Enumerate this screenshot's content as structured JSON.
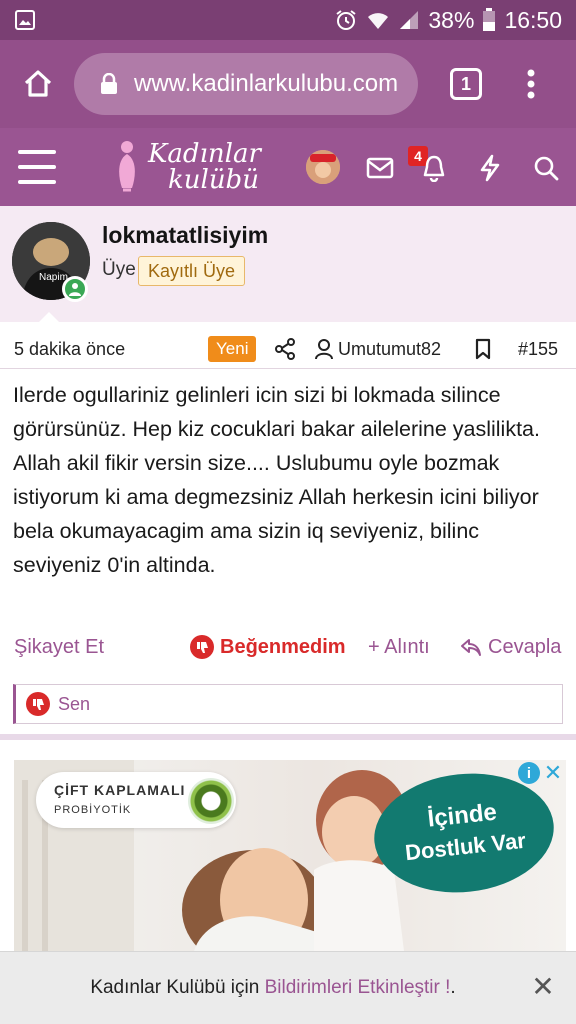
{
  "status_bar": {
    "battery": "38%",
    "time": "16:50"
  },
  "browser": {
    "url": "www.kadinlarkulubu.com",
    "tab_count": "1"
  },
  "site_header": {
    "logo_line1": "Kadınlar",
    "logo_line2": "kulübü",
    "notification_count": "4"
  },
  "post": {
    "username": "lokmatatlisiyim",
    "avatar_caption": "Napim",
    "role": "Üye",
    "role_badge": "Kayıtlı Üye",
    "time": "5 dakika önce",
    "new_badge": "Yeni",
    "quoted_user": "Umutumut82",
    "post_number": "#155",
    "message_lines": [
      "Ilerde ogullariniz gelinleri icin sizi bi lokmada silince görürsünüz. Hep kiz cocuklari bakar ailelerine yaslilikta.",
      "Allah akil fikir versin size.... Uslubumu oyle bozmak istiyorum ki ama degmezsiniz Allah herkesin icini biliyor bela okumayacagim ama sizin iq seviyeniz, bilinc seviyeniz 0'in altinda."
    ],
    "actions": {
      "report": "Şikayet Et",
      "dislike": "Beğenmedim",
      "quote": "+ Alıntı",
      "reply": "Cevapla"
    },
    "reaction_by": "Sen"
  },
  "ad": {
    "line1": "ÇİFT KAPLAMALI",
    "line2": "PROBİYOTİK",
    "bubble_line1": "İçinde",
    "bubble_line2": "Dostluk Var",
    "info": "i",
    "close": "✕"
  },
  "notify_bar": {
    "text": "Kadınlar Kulübü için",
    "link": "Bildirimleri Etkinleştir !",
    "suffix": ".",
    "close": "✕"
  },
  "colors": {
    "brand": "#9a5592",
    "accent_red": "#d92a2a",
    "new_badge": "#f08c1a",
    "online": "#3aa855"
  }
}
